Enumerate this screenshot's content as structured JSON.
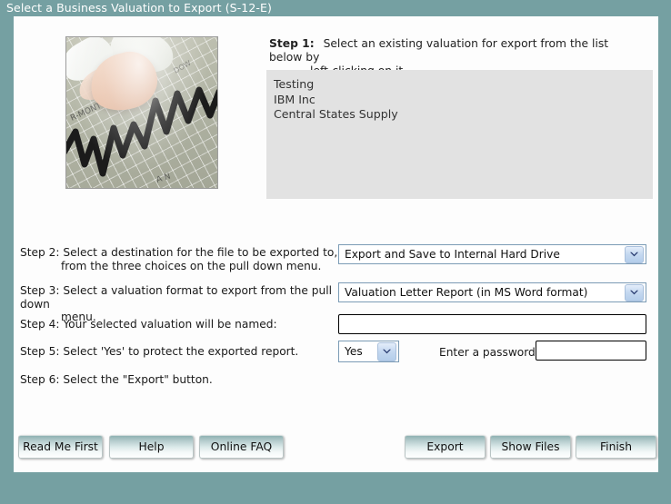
{
  "window": {
    "title": "Select a Business Valuation to Export (S-12-E)",
    "title_bar_color": "#75a0a2",
    "panel_color": "#fdfdfd"
  },
  "photo": {
    "alt": "Hands over a financial chart printed on newspaper"
  },
  "step1": {
    "label": "Step 1:",
    "text_line1": "Select an existing valuation for export from the list below by",
    "text_line2": "left-clicking on it",
    "list_items": [
      "Testing",
      "IBM Inc",
      "Central States Supply"
    ]
  },
  "step2": {
    "label_line1": "Step 2: Select a destination for the file to be exported to,",
    "label_line2": "from the three choices on the pull down menu.",
    "dropdown_value": "Export and Save to Internal Hard Drive",
    "dropdown_icon": "chevron-down-icon"
  },
  "step3": {
    "label_line1": "Step 3: Select a valuation format to export from the pull down",
    "label_line2": "menu.",
    "dropdown_value": "Valuation Letter Report (in MS Word format)",
    "dropdown_icon": "chevron-down-icon"
  },
  "step4": {
    "label": "Step 4: Your selected valuation will be named:",
    "input_value": "",
    "input_placeholder": ""
  },
  "step5": {
    "label": "Step 5: Select 'Yes' to protect the exported report.",
    "dropdown_value": "Yes",
    "dropdown_icon": "chevron-down-icon",
    "password_label": "Enter a password:",
    "password_value": "",
    "password_placeholder": ""
  },
  "step6": {
    "label": "Step 6: Select the \"Export\" button."
  },
  "buttons": {
    "left": [
      {
        "name": "read-me-first-button",
        "label": "Read Me First"
      },
      {
        "name": "help-button",
        "label": "Help"
      },
      {
        "name": "online-faq-button",
        "label": "Online FAQ"
      }
    ],
    "right": [
      {
        "name": "export-button",
        "label": "Export"
      },
      {
        "name": "show-files-button",
        "label": "Show Files"
      },
      {
        "name": "finish-button",
        "label": "Finish"
      }
    ]
  },
  "colors": {
    "accent": "#75a0a2",
    "listbox_bg": "#e2e2e2",
    "dropdown_border": "#7b9bb5",
    "dropdown_button": "#c4d8f0"
  }
}
